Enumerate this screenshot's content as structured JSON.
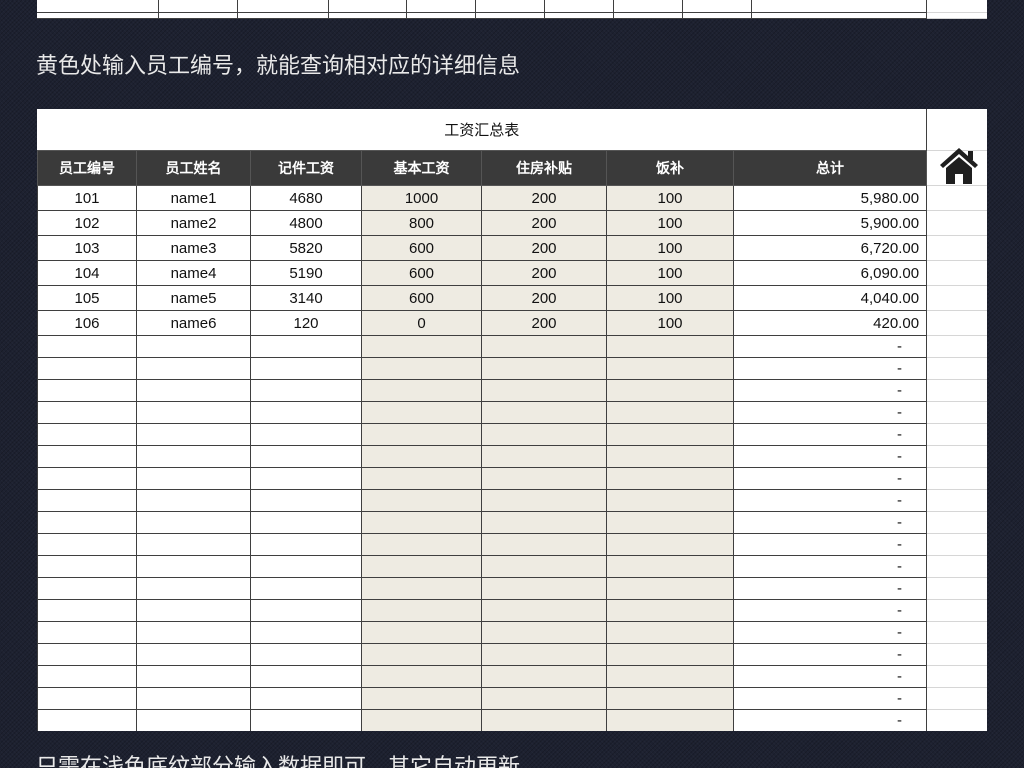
{
  "colors": {
    "page_background": "#1d2130",
    "instruction_text": "#e9e9e9",
    "header_background": "#3a3a3a",
    "header_text": "#ffffff",
    "input_fill": "#eeebe2",
    "grid_line": "#3f3f3f",
    "side_grid_line": "#d6d6d6",
    "icon_color": "#1f1f1f"
  },
  "instructions": {
    "top": "黄色处输入员工编号，就能查询相对应的详细信息",
    "bottom": "只需在浅色底纹部分输入数据即可，其它自动更新"
  },
  "sheet": {
    "title": "工资汇总表",
    "columns": [
      "员工编号",
      "员工姓名",
      "记件工资",
      "基本工资",
      "住房补贴",
      "饭补",
      "总计"
    ],
    "rows": [
      [
        "101",
        "name1",
        "4680",
        "1000",
        "200",
        "100",
        "5,980.00"
      ],
      [
        "102",
        "name2",
        "4800",
        "800",
        "200",
        "100",
        "5,900.00"
      ],
      [
        "103",
        "name3",
        "5820",
        "600",
        "200",
        "100",
        "6,720.00"
      ],
      [
        "104",
        "name4",
        "5190",
        "600",
        "200",
        "100",
        "6,090.00"
      ],
      [
        "105",
        "name5",
        "3140",
        "600",
        "200",
        "100",
        "4,040.00"
      ],
      [
        "106",
        "name6",
        "120",
        "0",
        "200",
        "100",
        "420.00"
      ]
    ],
    "blank_row_totals": [
      "-",
      "-",
      "-",
      "-",
      "-",
      "-",
      "-",
      "-",
      "-",
      "-",
      "-",
      "-",
      "-",
      "-",
      "-",
      "-",
      "-",
      "-"
    ],
    "home_link_icon": "home-icon"
  }
}
